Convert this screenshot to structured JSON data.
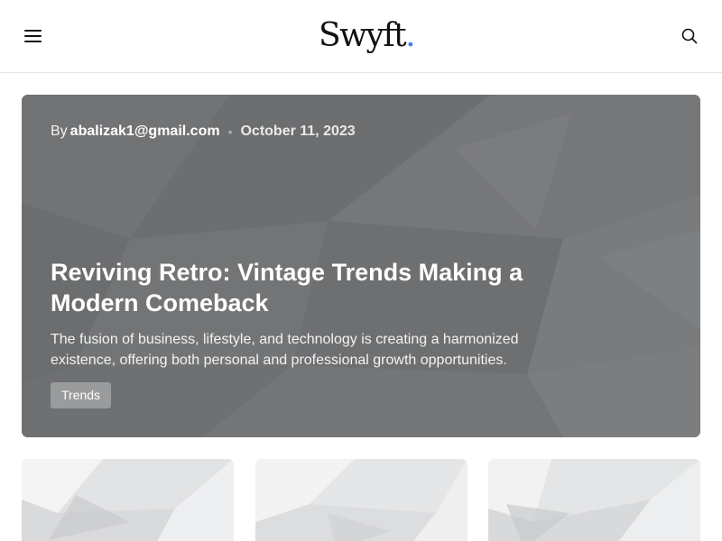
{
  "header": {
    "logo_text": "Swyft",
    "logo_dot": ".",
    "accent_color": "#3d7ef5",
    "menu_icon": "hamburger-menu-icon",
    "search_icon": "search-icon"
  },
  "hero": {
    "by_label": "By",
    "author": "abalizak1@gmail.com",
    "separator": "•",
    "date": "October 11, 2023",
    "title": "Reviving Retro: Vintage Trends Making a Modern Comeback",
    "excerpt": "The fusion of business, lifestyle, and technology is creating a harmonized existence, offering both personal and professional growth opportunities.",
    "tag": "Trends"
  },
  "cards": [
    {
      "image": "abstract-white-polygon-image"
    },
    {
      "image": "abstract-white-polygon-image"
    },
    {
      "image": "abstract-white-polygon-image"
    }
  ]
}
